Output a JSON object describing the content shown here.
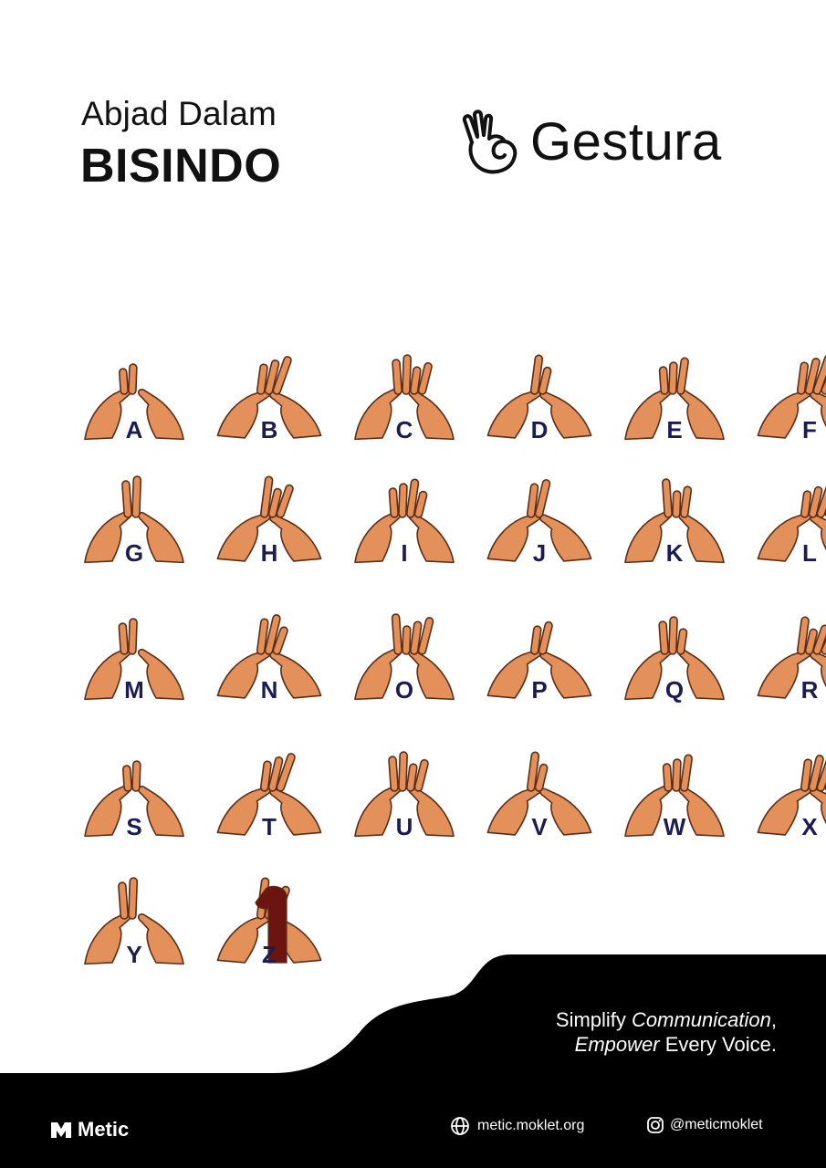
{
  "header": {
    "subtitle": "Abjad Dalam",
    "title": "BISINDO"
  },
  "brand": {
    "name": "Gestura",
    "logo_icon": "hand-ok-sign-icon"
  },
  "alphabet": [
    "A",
    "B",
    "C",
    "D",
    "E",
    "F",
    "G",
    "H",
    "I",
    "J",
    "K",
    "L",
    "M",
    "N",
    "O",
    "P",
    "Q",
    "R",
    "S",
    "T",
    "U",
    "V",
    "W",
    "X",
    "Y",
    "Z"
  ],
  "colors": {
    "skin": "#e3905a",
    "outline": "#5a2e18",
    "letter": "#1c1c54",
    "dark": "#000000",
    "z_mark": "#6b1410"
  },
  "tagline": {
    "line1_a": "Simplify ",
    "line1_b": "Communication",
    "line1_c": ",",
    "line2_a": "Empower ",
    "line2_b": "Every Voice",
    "line2_c": "."
  },
  "footer": {
    "org": "Metic",
    "website": "metic.moklet.org",
    "instagram": "@meticmoklet",
    "icons": [
      "metic-logo-icon",
      "globe-icon",
      "instagram-icon"
    ]
  }
}
